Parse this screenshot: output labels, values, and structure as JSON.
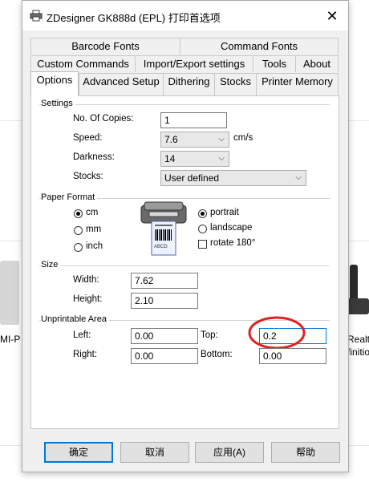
{
  "background": {
    "left_device_label": "MI-P",
    "right_device_label_1": "Realte",
    "right_device_label_2": "finitio"
  },
  "dialog": {
    "title": "ZDesigner GK888d (EPL) 打印首选项",
    "close_glyph": "✕"
  },
  "tabs": {
    "row1": [
      "Barcode Fonts",
      "Command Fonts"
    ],
    "row2": [
      "Custom Commands",
      "Import/Export settings",
      "Tools",
      "About"
    ],
    "row3": [
      "Options",
      "Advanced Setup",
      "Dithering",
      "Stocks",
      "Printer Memory"
    ],
    "active": "Options"
  },
  "settings": {
    "group_label": "Settings",
    "copies_label": "No. Of Copies:",
    "copies_value": "1",
    "speed_label": "Speed:",
    "speed_value": "7.6",
    "speed_unit": "cm/s",
    "darkness_label": "Darkness:",
    "darkness_value": "14",
    "stocks_label": "Stocks:",
    "stocks_value": "User defined"
  },
  "paper_format": {
    "group_label": "Paper Format",
    "unit_cm": "cm",
    "unit_mm": "mm",
    "unit_inch": "inch",
    "selected_unit": "cm",
    "orientation_portrait": "portrait",
    "orientation_landscape": "landscape",
    "rotate_label": "rotate 180°",
    "selected_orientation": "portrait",
    "rotate_checked": false,
    "label_sample_text": "ABCD",
    "label_sample_digits": "123456"
  },
  "size": {
    "group_label": "Size",
    "width_label": "Width:",
    "width_value": "7.62",
    "height_label": "Height:",
    "height_value": "2.10"
  },
  "unprintable": {
    "group_label": "Unprintable Area",
    "left_label": "Left:",
    "left_value": "0.00",
    "top_label": "Top:",
    "top_value": "0.2",
    "right_label": "Right:",
    "right_value": "0.00",
    "bottom_label": "Bottom:",
    "bottom_value": "0.00"
  },
  "buttons": {
    "ok": "确定",
    "cancel": "取消",
    "apply": "应用(A)",
    "help": "帮助"
  },
  "colors": {
    "highlight_circle": "#e02020",
    "focus_border": "#0078d7"
  }
}
